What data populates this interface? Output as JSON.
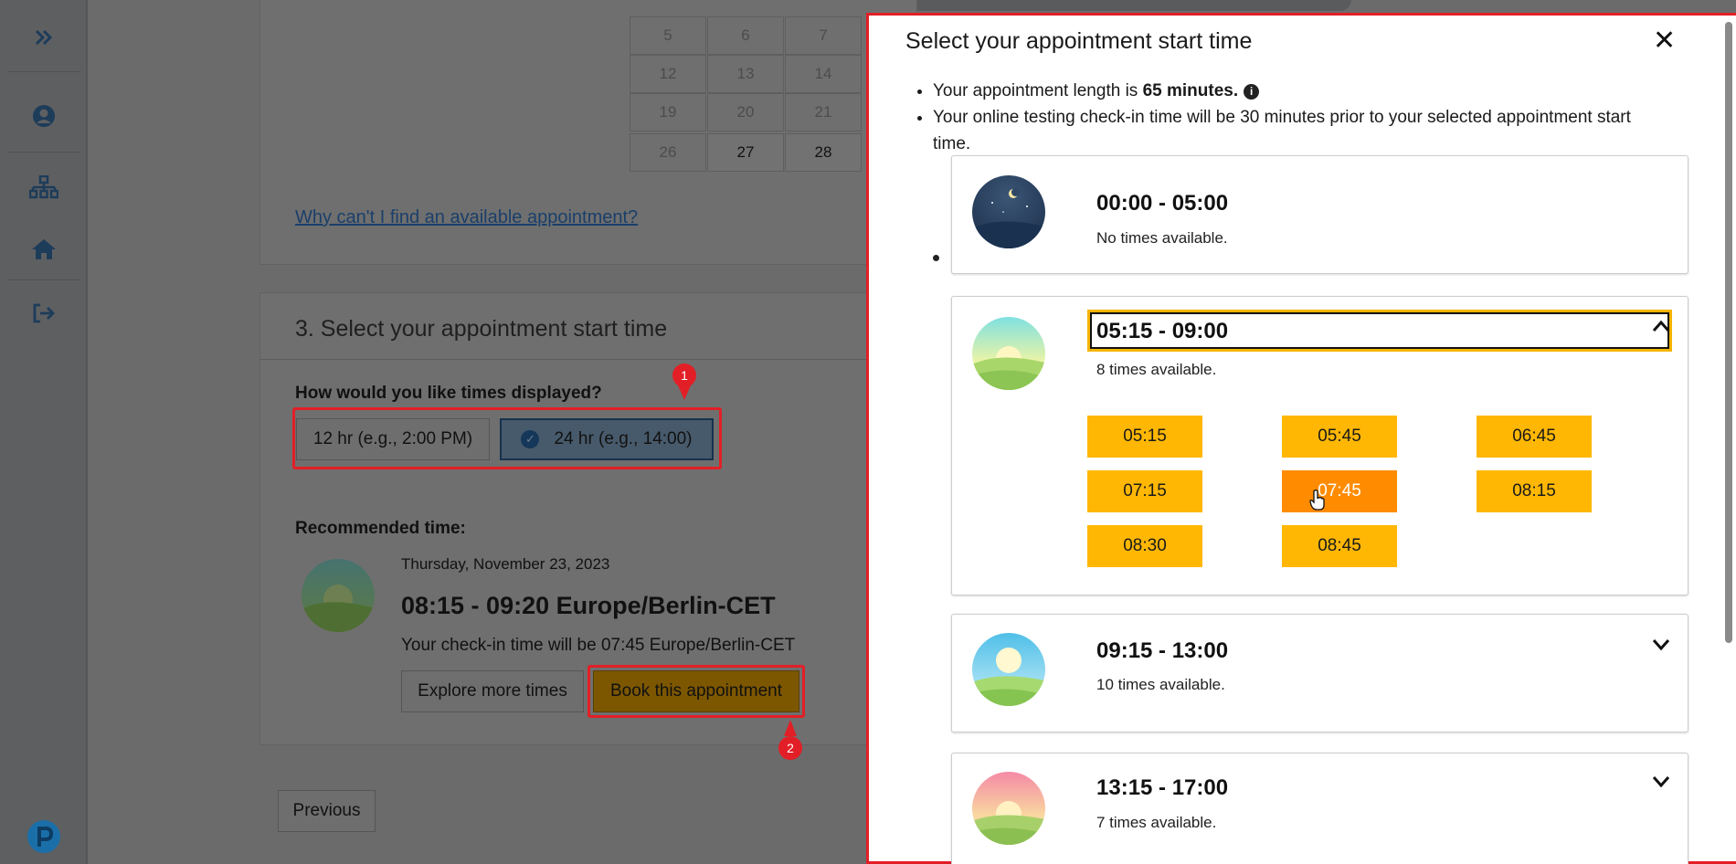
{
  "sidebar": {
    "icons": [
      "expand-icon",
      "user-icon",
      "sitemap-icon",
      "home-icon",
      "logout-icon",
      "pearson-logo-icon"
    ]
  },
  "calendar": {
    "rows": [
      [
        "5",
        "6",
        "7"
      ],
      [
        "12",
        "13",
        "14"
      ],
      [
        "19",
        "20",
        "21"
      ],
      [
        "26",
        "27",
        "28"
      ]
    ]
  },
  "availability_link": "Why can't I find an available appointment?",
  "section3": {
    "title": "3. Select your appointment start time",
    "display_question": "How would you like times displayed?",
    "option_12hr": "12 hr (e.g., 2:00 PM)",
    "option_24hr": "24 hr (e.g., 14:00)",
    "recommended_label": "Recommended time:",
    "recommended_date": "Thursday, November 23, 2023",
    "recommended_time": "08:15 - 09:20 Europe/Berlin-CET",
    "checkin_text": "Your check-in time will be 07:45 Europe/Berlin-CET",
    "explore_button": "Explore more times",
    "book_button": "Book this appointment",
    "previous_button": "Previous"
  },
  "markers": {
    "one": "1",
    "two": "2"
  },
  "modal": {
    "title": "Select your appointment start time",
    "close_label": "✕",
    "length_prefix": "Your appointment length is ",
    "length_value": "65 minutes.",
    "checkin_note": "Your online testing check-in time will be 30 minutes prior to your selected appointment start time.",
    "slots": [
      {
        "range": "00:00 - 05:00",
        "availability": "No times available.",
        "icon": "night-icon"
      },
      {
        "range": "05:15 - 09:00",
        "availability": "8 times available.",
        "icon": "sunrise-icon",
        "expanded": true,
        "times": [
          "05:15",
          "05:45",
          "06:45",
          "07:15",
          "07:45",
          "08:15",
          "08:30",
          "08:45"
        ]
      },
      {
        "range": "09:15 - 13:00",
        "availability": "10 times available.",
        "icon": "day-icon"
      },
      {
        "range": "13:15 - 17:00",
        "availability": "7 times available.",
        "icon": "sunset-icon"
      }
    ]
  },
  "colors": {
    "time_button": "#ffb703",
    "time_button_hover": "#ff8c00",
    "annotation_red": "#e21f26",
    "focus_outline": "#f5b400"
  }
}
